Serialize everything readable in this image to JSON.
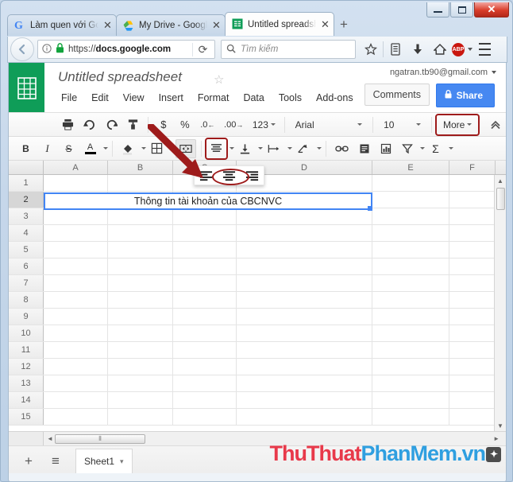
{
  "window": {
    "controls": {
      "minimize": "minimize",
      "maximize": "maximize",
      "close": "✕"
    }
  },
  "browser": {
    "tabs": [
      {
        "title": "Làm quen với Go",
        "favicon": "google-g-icon",
        "active": false,
        "close": "✕"
      },
      {
        "title": "My Drive - Googl",
        "favicon": "google-drive-icon",
        "active": false,
        "close": "✕"
      },
      {
        "title": "Untitled spreadsh",
        "favicon": "google-sheets-icon",
        "active": true,
        "close": "✕"
      }
    ],
    "new_tab_label": "+",
    "address": {
      "scheme": "https://",
      "host": "docs.google.com",
      "reload_glyph": "⟳"
    },
    "search": {
      "placeholder": "Tìm kiếm",
      "icon": "search-icon"
    },
    "nav_icons": [
      "star-icon",
      "reading-list-icon",
      "download-icon",
      "home-icon"
    ],
    "adblock_label": "ABP",
    "menu_icon": "hamburger-menu-icon"
  },
  "sheets": {
    "app_logo": "google-sheets-logo",
    "doc_title": "Untitled spreadsheet",
    "star_glyph": "☆",
    "menus": [
      "File",
      "Edit",
      "View",
      "Insert",
      "Format",
      "Data",
      "Tools",
      "Add-ons"
    ],
    "account_email": "ngatran.tb90@gmail.com",
    "comments_label": "Comments",
    "share_label": "Share",
    "share_icon": "lock-icon",
    "toolbar_row1": [
      {
        "name": "print-button",
        "glyph": "print-icon"
      },
      {
        "name": "undo-button",
        "glyph": "undo-icon"
      },
      {
        "name": "redo-button",
        "glyph": "redo-icon"
      },
      {
        "name": "paint-format-button",
        "glyph": "paint-format-icon"
      },
      {
        "name": "currency-format-button",
        "glyph": "$"
      },
      {
        "name": "percent-format-button",
        "glyph": "%"
      },
      {
        "name": "decrease-decimal-button",
        "glyph": ".0"
      },
      {
        "name": "increase-decimal-button",
        "glyph": ".00"
      },
      {
        "name": "more-formats-button",
        "glyph": "123"
      }
    ],
    "font_family": "Arial",
    "font_size": "10",
    "more_label": "More",
    "collapse_glyph": "⌃",
    "toolbar_row2": [
      {
        "name": "bold-button",
        "glyph": "B"
      },
      {
        "name": "italic-button",
        "glyph": "I"
      },
      {
        "name": "strikethrough-button",
        "glyph": "S"
      },
      {
        "name": "text-color-button",
        "glyph": "A"
      },
      {
        "name": "fill-color-button",
        "glyph": "fill-color-icon"
      },
      {
        "name": "borders-button",
        "glyph": "borders-icon"
      },
      {
        "name": "merge-cells-button",
        "glyph": "merge-cells-icon"
      },
      {
        "name": "horizontal-align-button",
        "glyph": "align-center-icon"
      },
      {
        "name": "vertical-align-button",
        "glyph": "vertical-align-icon"
      },
      {
        "name": "text-wrap-button",
        "glyph": "text-wrap-icon"
      },
      {
        "name": "text-rotation-button",
        "glyph": "text-rotation-icon"
      },
      {
        "name": "insert-link-button",
        "glyph": "link-icon"
      },
      {
        "name": "insert-comment-button",
        "glyph": "comment-icon"
      },
      {
        "name": "insert-chart-button",
        "glyph": "chart-icon"
      },
      {
        "name": "filter-button",
        "glyph": "filter-icon"
      },
      {
        "name": "functions-button",
        "glyph": "Σ"
      }
    ],
    "align_dropdown": {
      "options": [
        "align-left",
        "align-center",
        "align-right"
      ],
      "selected": "align-center"
    },
    "grid": {
      "columns": [
        "A",
        "B",
        "C",
        "D",
        "E",
        "F"
      ],
      "rows": [
        "1",
        "2",
        "3",
        "4",
        "5",
        "6",
        "7",
        "8",
        "9",
        "10",
        "11",
        "12",
        "13",
        "14",
        "15"
      ],
      "selected_row": "2",
      "merged_cell_text": "Thông tin tài khoản của CBCNVC"
    },
    "bottom": {
      "add_sheet_glyph": "+",
      "all_sheets_glyph": "≡",
      "sheet_name": "Sheet1",
      "sheet_caret": "▾"
    }
  },
  "watermark": {
    "part1": "ThuThuat",
    "part2": "PhanMem",
    "part3": ".vn",
    "badge": "✦"
  },
  "colors": {
    "sheets_green": "#0f9d58",
    "share_blue": "#4688f1",
    "selection_blue": "#4285f4",
    "annotation_red": "#9e1b1b",
    "watermark_red": "#e8394a",
    "watermark_blue": "#2f9fe0"
  }
}
